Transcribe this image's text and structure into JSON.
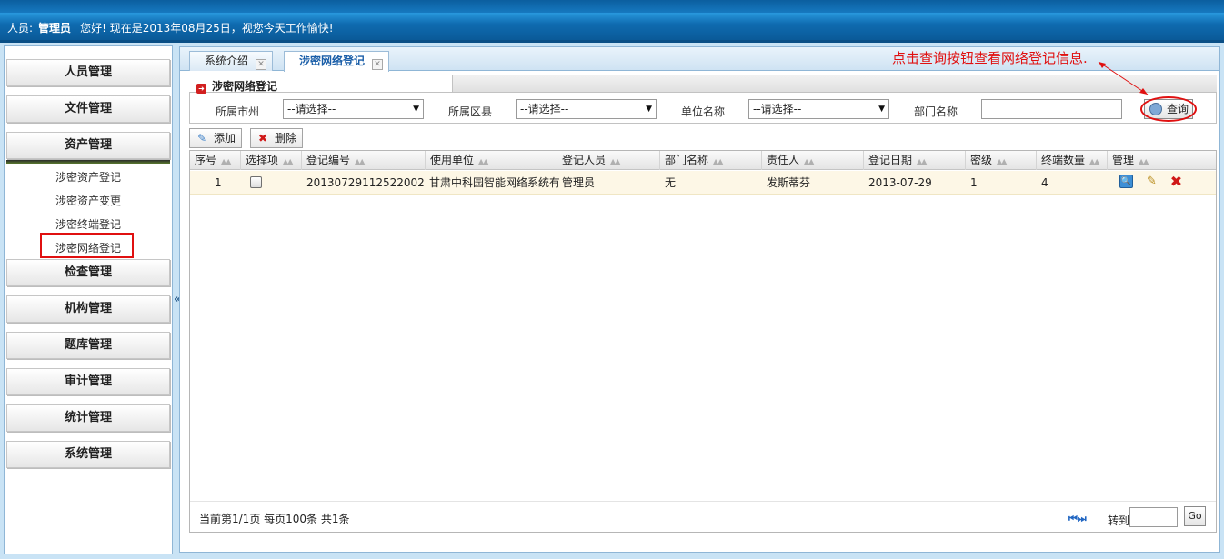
{
  "header": {
    "user_label": "人员:",
    "user_name": "管理员",
    "greeting": "您好!  现在是2013年08月25日，视您今天工作愉快!"
  },
  "sidebar": {
    "menus": [
      {
        "label": "人员管理"
      },
      {
        "label": "文件管理"
      },
      {
        "label": "资产管理"
      },
      {
        "label": "检查管理"
      },
      {
        "label": "机构管理"
      },
      {
        "label": "题库管理"
      },
      {
        "label": "审计管理"
      },
      {
        "label": "统计管理"
      },
      {
        "label": "系统管理"
      }
    ],
    "sub_items": [
      {
        "label": "涉密资产登记"
      },
      {
        "label": "涉密资产变更"
      },
      {
        "label": "涉密终端登记"
      },
      {
        "label": "涉密网络登记"
      }
    ],
    "collapse_glyph": "«"
  },
  "tabs": [
    {
      "label": "系统介绍"
    },
    {
      "label": "涉密网络登记"
    }
  ],
  "annotation": "点击查询按钮查看网络登记信息.",
  "form": {
    "title": "涉密网络登记",
    "fields": [
      {
        "label": "所属市州",
        "value": "--请选择--"
      },
      {
        "label": "所属区县",
        "value": "--请选择--"
      },
      {
        "label": "单位名称",
        "value": "--请选择--"
      },
      {
        "label": "部门名称",
        "value": ""
      }
    ],
    "query_label": "查询"
  },
  "toolbar": {
    "add_label": "添加",
    "delete_label": "删除"
  },
  "grid": {
    "columns": [
      "序号",
      "选择项",
      "登记编号",
      "使用单位",
      "登记人员",
      "部门名称",
      "责任人",
      "登记日期",
      "密级",
      "终端数量",
      "管理"
    ],
    "rows": [
      {
        "seq": "1",
        "reg_no": "20130729112522002",
        "unit": "甘肃中科园智能网络系统有",
        "registrar": "管理员",
        "dept": "无",
        "owner": "发斯蒂芬",
        "date": "2013-07-29",
        "level": "1",
        "terminals": "4"
      }
    ]
  },
  "footer": {
    "status": "当前第1/1页  每页100条  共1条",
    "goto_label": "转到",
    "go_label": "Go",
    "page_nav": "⏮ ⏭"
  },
  "colors": {
    "header_blue": "#1a7cc4",
    "accent_red": "#e01010",
    "row_highlight": "#fdf7e6"
  }
}
